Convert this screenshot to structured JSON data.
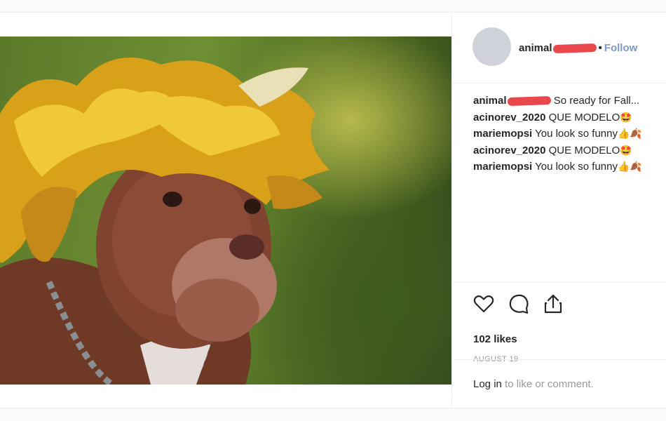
{
  "post": {
    "username": "animal",
    "follow_label": "Follow",
    "separator": "•",
    "likes": "102 likes",
    "date": "AUGUST 19",
    "login_link": "Log in",
    "login_text": " to like or comment."
  },
  "comments": [
    {
      "user": "animal",
      "text": "So ready for Fall...",
      "emoji": "",
      "redacted": true
    },
    {
      "user": "acinorev_2020",
      "text": "QUE MODELO",
      "emoji": "🤩",
      "redacted": false
    },
    {
      "user": "mariemopsi",
      "text": "You look so funny",
      "emoji": "👍🍂",
      "redacted": false
    },
    {
      "user": "acinorev_2020",
      "text": "QUE MODELO",
      "emoji": "🤩",
      "redacted": false
    },
    {
      "user": "mariemopsi",
      "text": "You look so funny",
      "emoji": "👍🍂",
      "redacted": false
    }
  ],
  "icons": [
    "heart-icon",
    "comment-icon",
    "share-icon"
  ],
  "colors": {
    "follow": "#7b9ac7",
    "redaction": "#e8474b",
    "avatar": "#cfd3d9"
  }
}
